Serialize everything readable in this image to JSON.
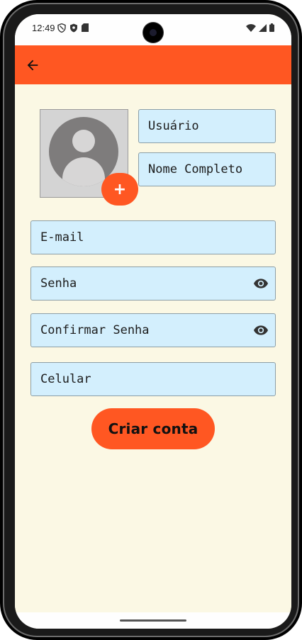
{
  "status_bar": {
    "time": "12:49",
    "left_icons": [
      "shield-icon",
      "vpn-icon",
      "sim-card-icon"
    ],
    "right_icons": [
      "wifi-icon",
      "signal-icon",
      "battery-icon"
    ]
  },
  "app_bar": {
    "color": "#ff5722",
    "back_icon": "arrow-left-icon"
  },
  "avatar": {
    "icon": "person-icon",
    "add_label": "+"
  },
  "form": {
    "username_placeholder": "Usuário",
    "fullname_placeholder": "Nome Completo",
    "email_placeholder": "E-mail",
    "password_placeholder": "Senha",
    "confirm_password_placeholder": "Confirmar Senha",
    "phone_placeholder": "Celular",
    "password_toggle_icon": "eye-icon"
  },
  "actions": {
    "create_account_label": "Criar conta"
  },
  "colors": {
    "accent": "#ff5722",
    "background": "#fbf8e4",
    "field_fill": "#d3effd"
  }
}
